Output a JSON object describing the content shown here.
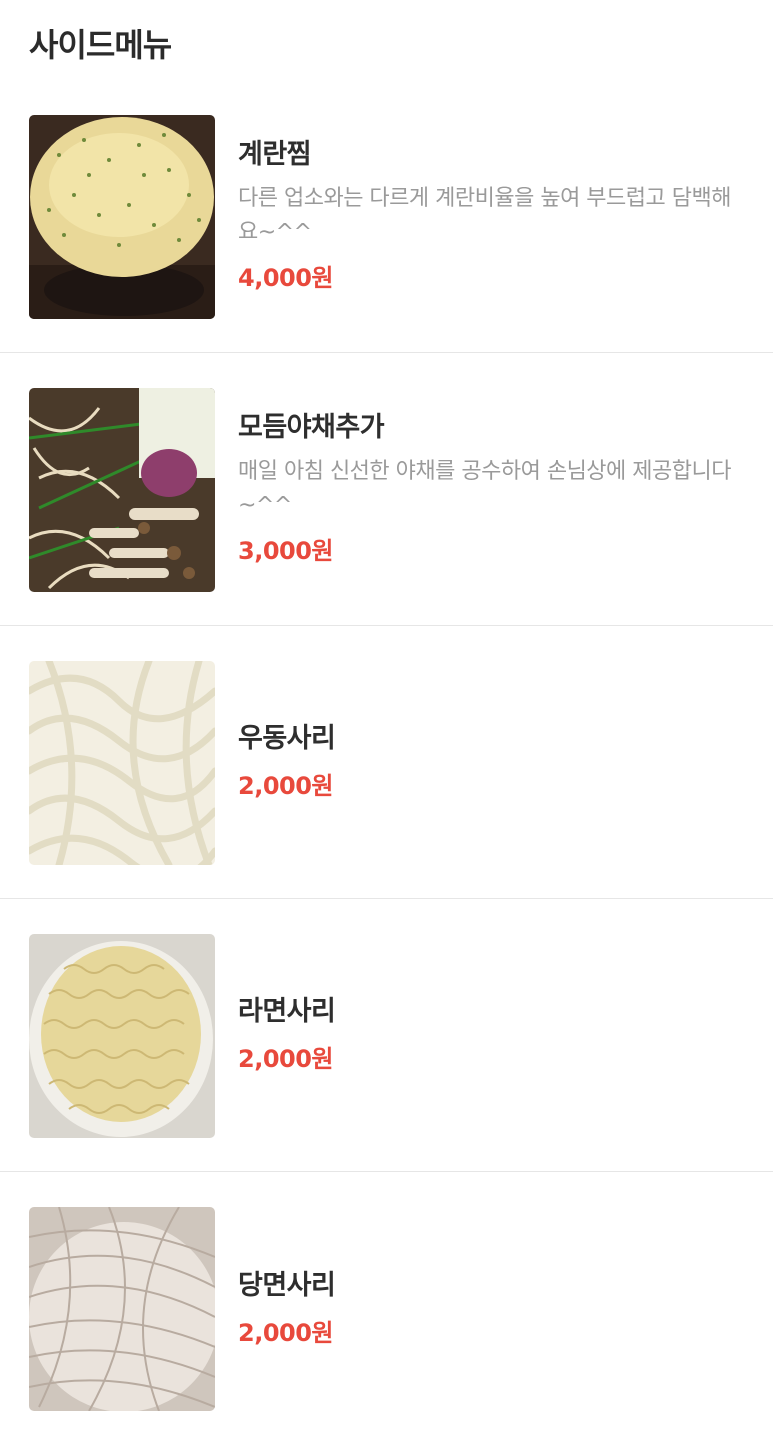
{
  "section": {
    "title": "사이드메뉴"
  },
  "items": [
    {
      "name": "계란찜",
      "description": "다른 업소와는 다르게 계란비율을 높여 부드럽고 담백해요~^^",
      "price": "4,000원",
      "image_icon": "steamed-egg-photo"
    },
    {
      "name": "모듬야채추가",
      "description": "매일 아침 신선한 야채를 공수하여 손님상에 제공합니다~^^",
      "price": "3,000원",
      "image_icon": "vegetables-photo"
    },
    {
      "name": "우동사리",
      "description": "",
      "price": "2,000원",
      "image_icon": "udon-noodles-photo"
    },
    {
      "name": "라면사리",
      "description": "",
      "price": "2,000원",
      "image_icon": "ramen-noodles-photo"
    },
    {
      "name": "당면사리",
      "description": "",
      "price": "2,000원",
      "image_icon": "glass-noodles-photo"
    }
  ],
  "colors": {
    "price": "#e8493c",
    "title": "#2b2b2b",
    "description": "#9a9a9a",
    "divider": "#e6e6e6"
  }
}
